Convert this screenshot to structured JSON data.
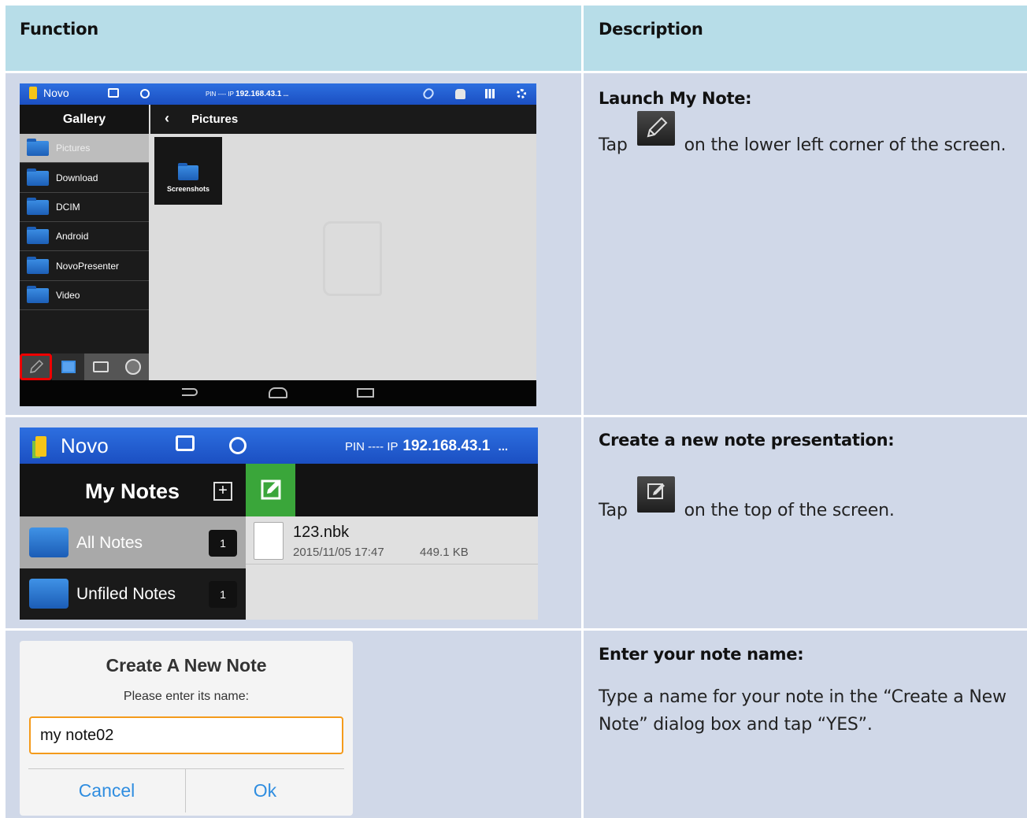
{
  "header": {
    "function": "Function",
    "description": "Description"
  },
  "row1": {
    "title": "Launch My Note:",
    "text_before": "Tap",
    "text_after": "on the lower left corner of the screen.",
    "screen": {
      "app_name": "Novo",
      "pin_label": "PIN ---- IP",
      "ip": "192.168.43.1",
      "more": "...",
      "sidebar_title": "Gallery",
      "content_title": "Pictures",
      "back": "‹",
      "folders": [
        "Pictures",
        "Download",
        "DCIM",
        "Android",
        "NovoPresenter",
        "Video"
      ],
      "tile_label": "Screenshots"
    }
  },
  "row2": {
    "title": "Create a new note presentation:",
    "text_before": "Tap",
    "text_after": "on the top of the screen.",
    "screen": {
      "app_name": "Novo",
      "pin_label": "PIN ---- IP",
      "ip": "192.168.43.1",
      "more": "...",
      "section_title": "My Notes",
      "add_symbol": "+",
      "categories": [
        {
          "label": "All Notes",
          "count": "1"
        },
        {
          "label": "Unfiled Notes",
          "count": "1"
        }
      ],
      "file": {
        "name": "123.nbk",
        "date": "2015/11/05 17:47",
        "size": "449.1 KB"
      }
    }
  },
  "row3": {
    "title": "Enter your note name:",
    "text": "Type a name for your note in the “Create a New Note” dialog box and tap “YES”.",
    "dialog": {
      "title": "Create A New Note",
      "prompt": "Please enter its name:",
      "value": "my note02",
      "cancel": "Cancel",
      "ok": "Ok"
    }
  },
  "colors": {
    "header_bg": "#b7dde8",
    "row_bg": "#d0d8e8",
    "novo_bar": "#2d6fe0",
    "accent_green": "#3aa63a",
    "dialog_border": "#f49a1b",
    "dialog_button": "#2f8de0"
  }
}
